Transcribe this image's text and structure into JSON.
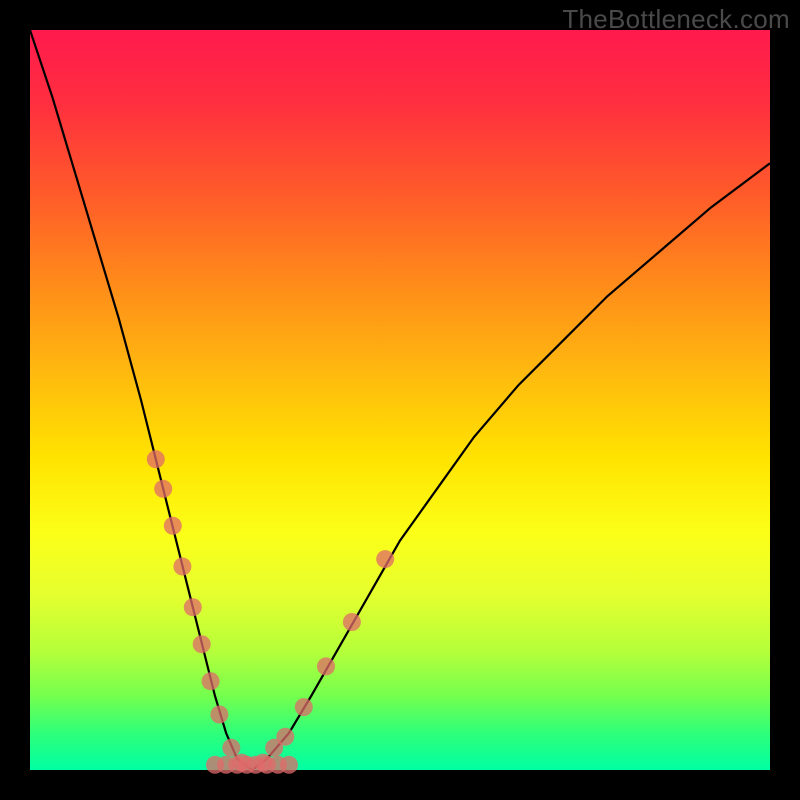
{
  "watermark": "TheBottleneck.com",
  "chart_data": {
    "type": "line",
    "title": "",
    "xlabel": "",
    "ylabel": "",
    "xlim": [
      0,
      100
    ],
    "ylim": [
      0,
      100
    ],
    "curve": {
      "name": "bottleneck-curve",
      "x": [
        0,
        3,
        6,
        9,
        12,
        15,
        17,
        19,
        20.5,
        22,
        23.5,
        25,
        26.5,
        28,
        30,
        32,
        35,
        38,
        42,
        46,
        50,
        55,
        60,
        66,
        72,
        78,
        85,
        92,
        100
      ],
      "y": [
        100,
        91,
        81,
        71,
        61,
        50,
        42,
        34,
        28,
        22,
        16,
        10,
        5,
        1.5,
        0,
        1.5,
        5,
        10,
        17,
        24,
        31,
        38,
        45,
        52,
        58,
        64,
        70,
        76,
        82
      ]
    },
    "dots_left": {
      "name": "left-branch-markers",
      "x": [
        17.0,
        18.0,
        19.3,
        20.6,
        22.0,
        23.2,
        24.4,
        25.6,
        27.2,
        28.6
      ],
      "y": [
        42.0,
        38.0,
        33.0,
        27.5,
        22.0,
        17.0,
        12.0,
        7.5,
        3.0,
        1.0
      ]
    },
    "dots_right": {
      "name": "right-branch-markers",
      "x": [
        31.5,
        33.0,
        34.5,
        37.0,
        40.0,
        43.5,
        48.0
      ],
      "y": [
        1.0,
        3.0,
        4.5,
        8.5,
        14.0,
        20.0,
        28.5
      ]
    },
    "dots_bottom": {
      "name": "bottom-markers",
      "x": [
        25.0,
        26.5,
        28.0,
        29.3,
        30.5,
        32.0,
        33.5,
        35.0
      ],
      "y": [
        0.7,
        0.7,
        0.7,
        0.7,
        0.7,
        0.7,
        0.7,
        0.7
      ]
    },
    "marker_style": {
      "fill": "#e06a6a",
      "opacity": 0.75,
      "r": 9
    },
    "line_style": {
      "stroke": "#000000",
      "width": 2.2
    }
  }
}
